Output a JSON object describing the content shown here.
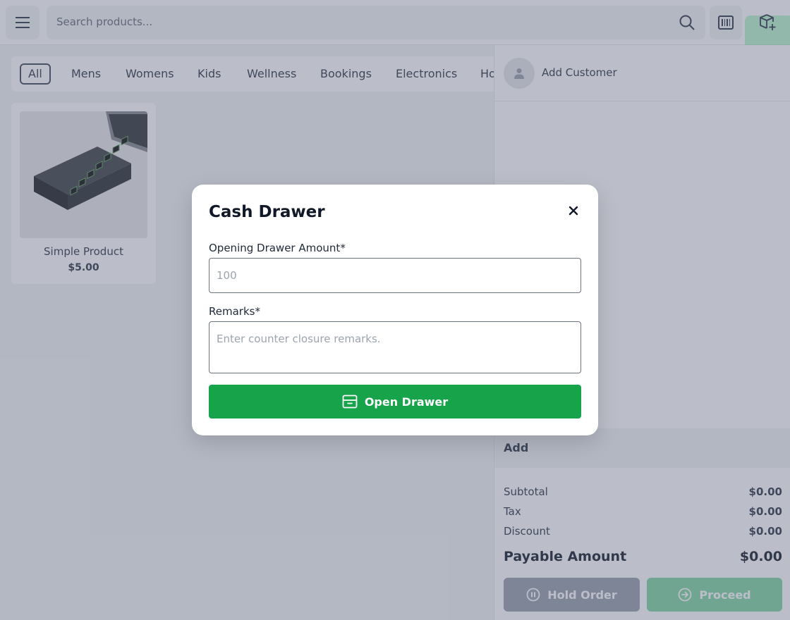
{
  "search": {
    "placeholder": "Search products..."
  },
  "categories": [
    "All",
    "Mens",
    "Womens",
    "Kids",
    "Wellness",
    "Bookings",
    "Electronics",
    "Ho"
  ],
  "products": [
    {
      "name": "Simple Product",
      "price": "$5.00"
    }
  ],
  "customer": {
    "label": "Add Customer"
  },
  "cart": {
    "add_label": "Add",
    "subtotal_label": "Subtotal",
    "subtotal": "$0.00",
    "tax_label": "Tax",
    "tax": "$0.00",
    "discount_label": "Discount",
    "discount": "$0.00",
    "payable_label": "Payable Amount",
    "payable": "$0.00",
    "hold_label": "Hold Order",
    "proceed_label": "Proceed"
  },
  "modal": {
    "title": "Cash Drawer",
    "amount_label": "Opening Drawer Amount*",
    "amount_placeholder": "100",
    "remarks_label": "Remarks*",
    "remarks_placeholder": "Enter counter closure remarks.",
    "submit_label": "Open Drawer"
  },
  "colors": {
    "primary_green": "#16a34a",
    "overlay": "rgba(75,85,110,0.38)"
  },
  "icons": [
    "menu-icon",
    "search-icon",
    "barcode-icon",
    "box-plus-icon",
    "user-icon",
    "pause-icon",
    "arrow-right-circle-icon",
    "close-icon",
    "drawer-icon"
  ]
}
